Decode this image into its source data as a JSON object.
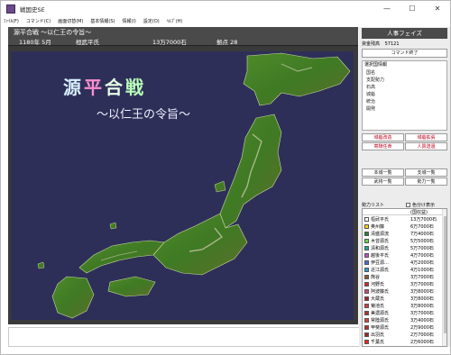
{
  "window": {
    "title": "戦国史SE",
    "controls": [
      "—",
      "☐",
      "✕"
    ]
  },
  "menu": [
    "ﾌｧｲﾙ(F)",
    "コマンド(C)",
    "画面切替(M)",
    "基本情報(S)",
    "情報(I)",
    "設定(O)",
    "ﾍﾙﾌﾟ(H)"
  ],
  "status": {
    "scenario": "源平合戦 ～以仁王の令旨～",
    "date": "1180年 5月",
    "clan": "桓武平氏",
    "koku": "13万7000石",
    "bases": "拠点 28"
  },
  "map": {
    "title": [
      "源",
      "平",
      "合",
      "戦"
    ],
    "subtitle": "～以仁王の令旨～"
  },
  "side": {
    "header": "人事フェイズ",
    "funds_label": "資金残高",
    "funds_value": "57121",
    "end_command": "コマンド終了",
    "info_title": "選択国情報",
    "info_rows": [
      "国名",
      "支配勢力",
      "石高",
      "城砦",
      "統治",
      "開発"
    ],
    "buttons": [
      "城砦改造",
      "城砦拡張",
      "寄騎任命",
      "人質送還"
    ],
    "lists": [
      "本城一覧",
      "支城一覧",
      "武将一覧",
      "勢力一覧"
    ],
    "forces_label": "勢力リスト",
    "forces_toggle": "色分け表示",
    "forces_header": "(国収益)",
    "forces": [
      {
        "name": "桓武平氏",
        "value": "13万7000石",
        "color": "#ffffff"
      },
      {
        "name": "奥州藤",
        "value": "6万7000石",
        "color": "#ffd400"
      },
      {
        "name": "清盛源流",
        "value": "7万4000石",
        "color": "#2e7d32"
      },
      {
        "name": "木曾源氏",
        "value": "5万5000石",
        "color": "#6ad44a"
      },
      {
        "name": "清和源氏",
        "value": "5万7000石",
        "color": "#1ba88c"
      },
      {
        "name": "越後平氏",
        "value": "4万7000石",
        "color": "#c04ac0"
      },
      {
        "name": "伊豆源…",
        "value": "4万2000石",
        "color": "#4a6ad4"
      },
      {
        "name": "近江源氏",
        "value": "4万1000石",
        "color": "#2a9ed4"
      },
      {
        "name": "熊谷",
        "value": "3万7000石",
        "color": "#8b5a2b"
      },
      {
        "name": "河野氏",
        "value": "3万7000石",
        "color": "#cc2a2a"
      },
      {
        "name": "阿波藤氏",
        "value": "3万8000石",
        "color": "#c04a7a"
      },
      {
        "name": "大蔵氏",
        "value": "3万8000石",
        "color": "#a02828"
      },
      {
        "name": "菊池氏",
        "value": "3万8000石",
        "color": "#d43a3a"
      },
      {
        "name": "美濃源氏",
        "value": "3万7000石",
        "color": "#b03030"
      },
      {
        "name": "常陸源氏",
        "value": "3万4000石",
        "color": "#e04040"
      },
      {
        "name": "甲斐源氏",
        "value": "2万9000石",
        "color": "#b82c2c"
      },
      {
        "name": "出羽氏",
        "value": "2万7000石",
        "color": "#9a2a2a"
      },
      {
        "name": "千葉氏",
        "value": "2万6000石",
        "color": "#ff2020"
      }
    ]
  }
}
